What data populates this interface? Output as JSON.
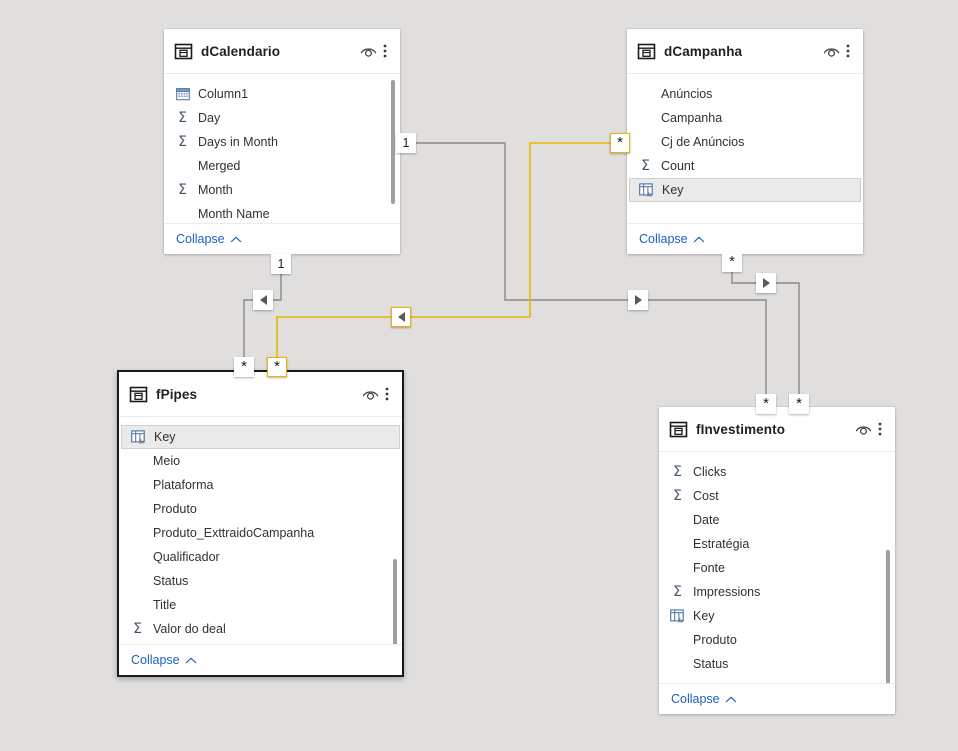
{
  "app": {
    "view": "model-view",
    "background_color": "#e1dfdd",
    "relationship_color": "#8a8886",
    "highlight_color": "#e8b600"
  },
  "tables": [
    {
      "id": "dCalendario",
      "name": "dCalendario",
      "selected": false,
      "collapse_label": "Collapse",
      "fields": [
        {
          "label": "Column1",
          "icon": "calendar-icon",
          "highlighted": false
        },
        {
          "label": "Day",
          "icon": "sigma-icon",
          "highlighted": false
        },
        {
          "label": "Days in Month",
          "icon": "sigma-icon",
          "highlighted": false
        },
        {
          "label": "Merged",
          "icon": "none",
          "highlighted": false
        },
        {
          "label": "Month",
          "icon": "sigma-icon",
          "highlighted": false
        },
        {
          "label": "Month Name",
          "icon": "none",
          "highlighted": false
        }
      ]
    },
    {
      "id": "dCampanha",
      "name": "dCampanha",
      "selected": false,
      "collapse_label": "Collapse",
      "fields": [
        {
          "label": "Anúncios",
          "icon": "none",
          "highlighted": false
        },
        {
          "label": "Campanha",
          "icon": "none",
          "highlighted": false
        },
        {
          "label": "Cj de Anúncios",
          "icon": "none",
          "highlighted": false
        },
        {
          "label": "Count",
          "icon": "sigma-icon",
          "highlighted": false
        },
        {
          "label": "Key",
          "icon": "calc-column-icon",
          "highlighted": true
        }
      ]
    },
    {
      "id": "fPipes",
      "name": "fPipes",
      "selected": true,
      "collapse_label": "Collapse",
      "fields": [
        {
          "label": "Key",
          "icon": "calc-column-icon",
          "highlighted": true
        },
        {
          "label": "Meio",
          "icon": "none",
          "highlighted": false
        },
        {
          "label": "Plataforma",
          "icon": "none",
          "highlighted": false
        },
        {
          "label": "Produto",
          "icon": "none",
          "highlighted": false
        },
        {
          "label": "Produto_ExttraidoCampanha",
          "icon": "none",
          "highlighted": false
        },
        {
          "label": "Qualificador",
          "icon": "none",
          "highlighted": false
        },
        {
          "label": "Status",
          "icon": "none",
          "highlighted": false
        },
        {
          "label": "Title",
          "icon": "none",
          "highlighted": false
        },
        {
          "label": "Valor do deal",
          "icon": "sigma-icon",
          "highlighted": false
        }
      ]
    },
    {
      "id": "fInvestimento",
      "name": "fInvestimento",
      "selected": false,
      "collapse_label": "Collapse",
      "fields": [
        {
          "label": "Clicks",
          "icon": "sigma-icon",
          "highlighted": false
        },
        {
          "label": "Cost",
          "icon": "sigma-icon",
          "highlighted": false
        },
        {
          "label": "Date",
          "icon": "none",
          "highlighted": false
        },
        {
          "label": "Estratégia",
          "icon": "none",
          "highlighted": false
        },
        {
          "label": "Fonte",
          "icon": "none",
          "highlighted": false
        },
        {
          "label": "Impressions",
          "icon": "sigma-icon",
          "highlighted": false
        },
        {
          "label": "Key",
          "icon": "calc-column-icon",
          "highlighted": false
        },
        {
          "label": "Produto",
          "icon": "none",
          "highlighted": false
        },
        {
          "label": "Status",
          "icon": "none",
          "highlighted": false
        }
      ]
    }
  ],
  "header_icons": {
    "eye": "eye-icon",
    "menu": "more-options-icon"
  },
  "relationship_badges": [
    {
      "id": "b-dcal-bottom-one",
      "symbol": "1",
      "kind": "one",
      "highlighted": false
    },
    {
      "id": "b-dcal-right-one",
      "symbol": "1",
      "kind": "one",
      "highlighted": false
    },
    {
      "id": "b-fpipes-top-star-a",
      "symbol": "*",
      "kind": "star",
      "highlighted": false
    },
    {
      "id": "b-fpipes-top-star-b",
      "symbol": "*",
      "kind": "star",
      "highlighted": true
    },
    {
      "id": "b-dcamp-right-star",
      "symbol": "*",
      "kind": "star",
      "highlighted": true
    },
    {
      "id": "b-dcamp-bottom-star",
      "symbol": "*",
      "kind": "star",
      "highlighted": false
    },
    {
      "id": "b-finv-top-star-a",
      "symbol": "*",
      "kind": "star",
      "highlighted": false
    },
    {
      "id": "b-finv-top-star-b",
      "symbol": "*",
      "kind": "star",
      "highlighted": false
    },
    {
      "id": "a-left-dcal",
      "symbol": "◀",
      "kind": "arrow-left",
      "highlighted": false
    },
    {
      "id": "a-left-yellow",
      "symbol": "◀",
      "kind": "arrow-left",
      "highlighted": true
    },
    {
      "id": "a-right-mid",
      "symbol": "▶",
      "kind": "arrow-right",
      "highlighted": false
    },
    {
      "id": "a-right-upper",
      "symbol": "▶",
      "kind": "arrow-right",
      "highlighted": false
    }
  ]
}
